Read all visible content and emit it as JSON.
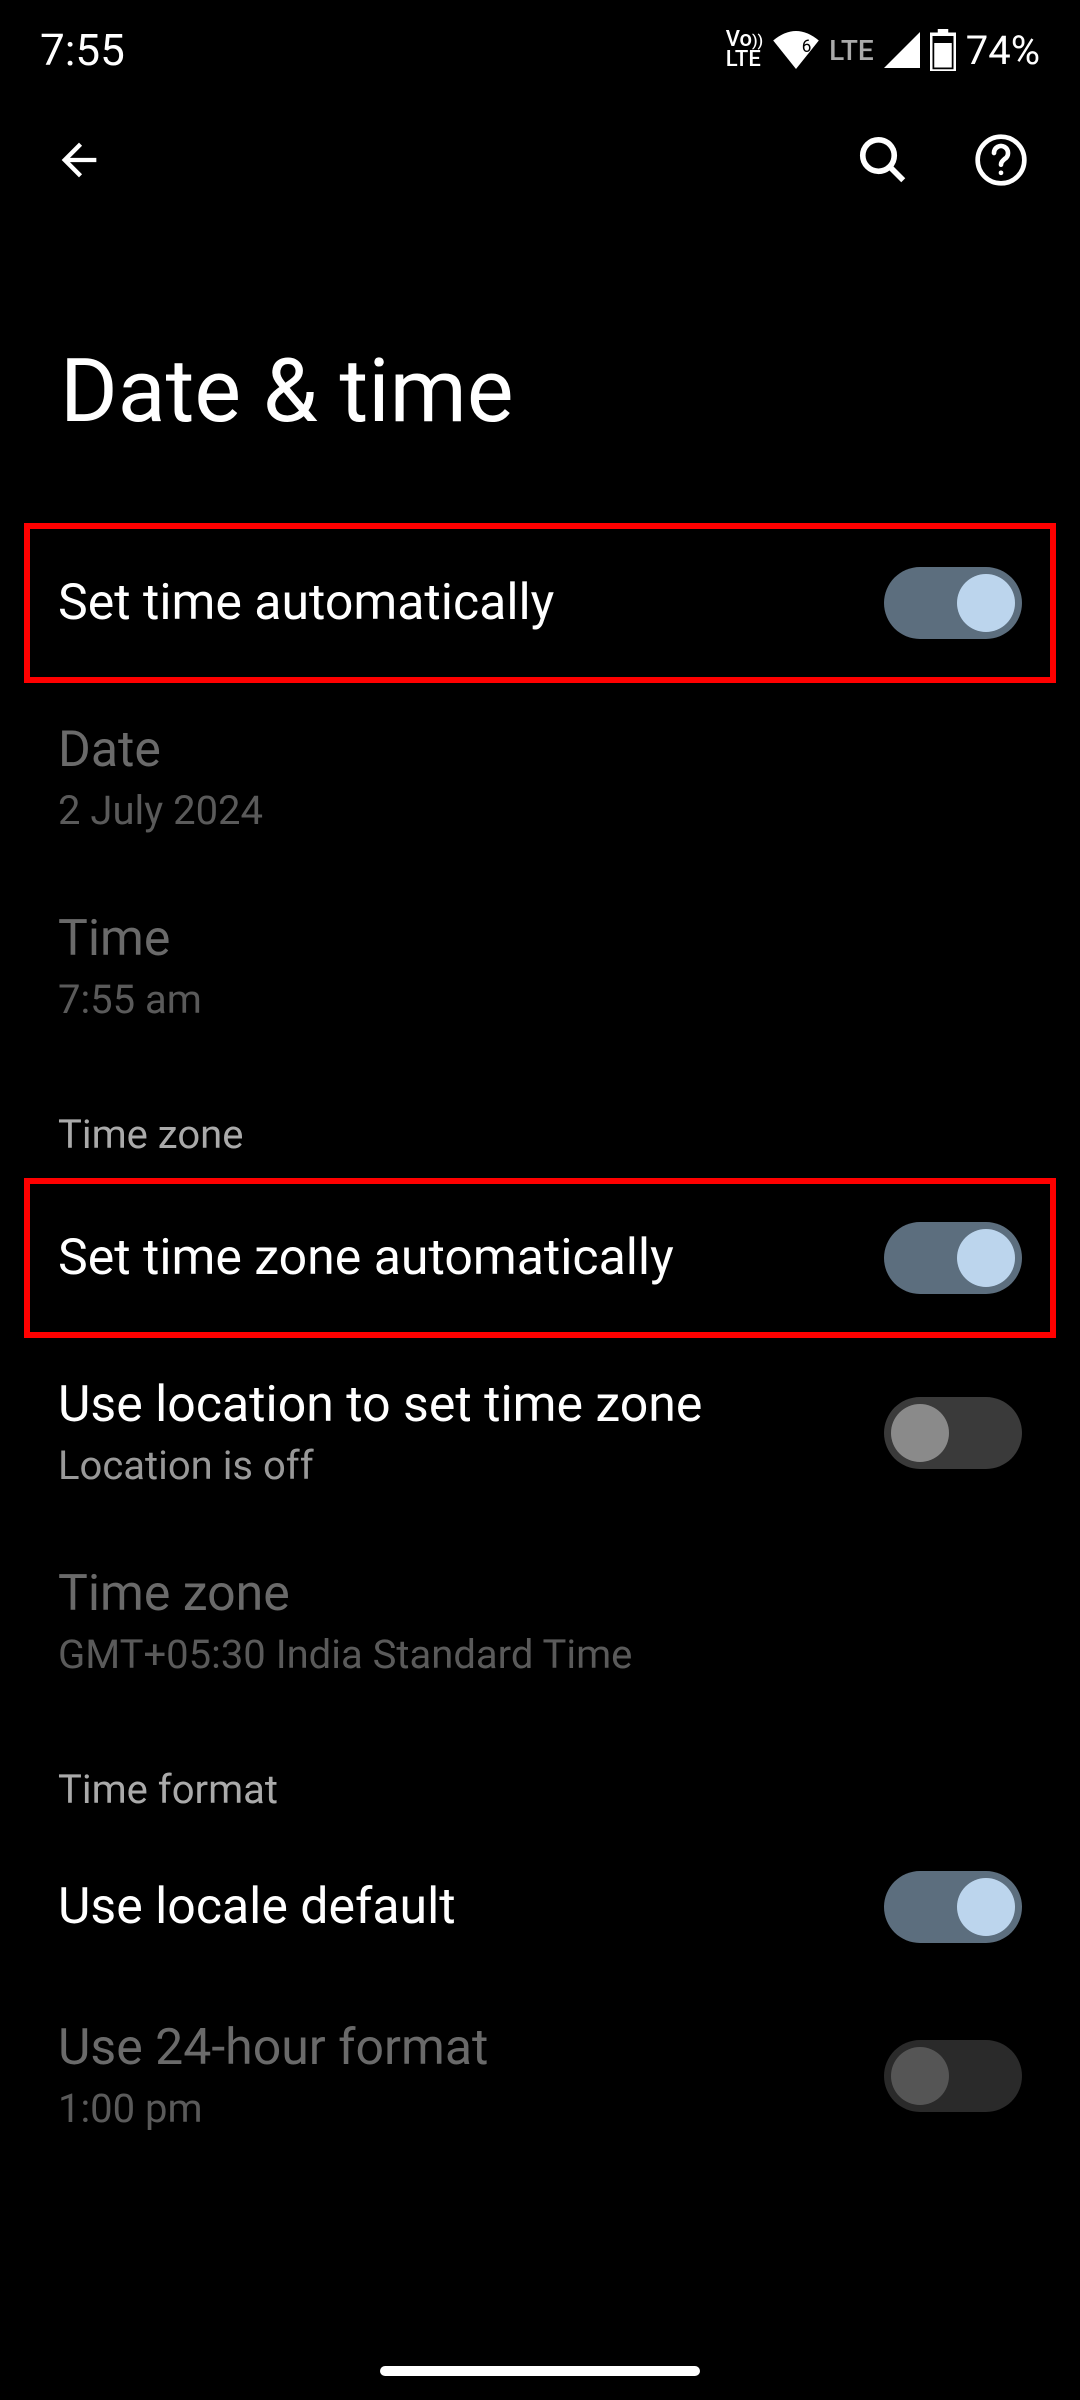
{
  "status_bar": {
    "time": "7:55",
    "volte": "Vo\nLTE",
    "lte": "LTE",
    "battery": "74%"
  },
  "header": {
    "title": "Date & time"
  },
  "sections": {
    "set_time_auto": {
      "label": "Set time automatically",
      "on": true
    },
    "date": {
      "label": "Date",
      "value": "2 July 2024"
    },
    "time": {
      "label": "Time",
      "value": "7:55 am"
    },
    "tz_header": "Time zone",
    "set_tz_auto": {
      "label": "Set time zone automatically",
      "on": true
    },
    "use_location": {
      "label": "Use location to set time zone",
      "sub": "Location is off",
      "on": false
    },
    "time_zone": {
      "label": "Time zone",
      "value": "GMT+05:30 India Standard Time"
    },
    "format_header": "Time format",
    "use_locale": {
      "label": "Use locale default",
      "on": true
    },
    "use_24h": {
      "label": "Use 24-hour format",
      "sub": "1:00 pm",
      "on": false
    }
  }
}
